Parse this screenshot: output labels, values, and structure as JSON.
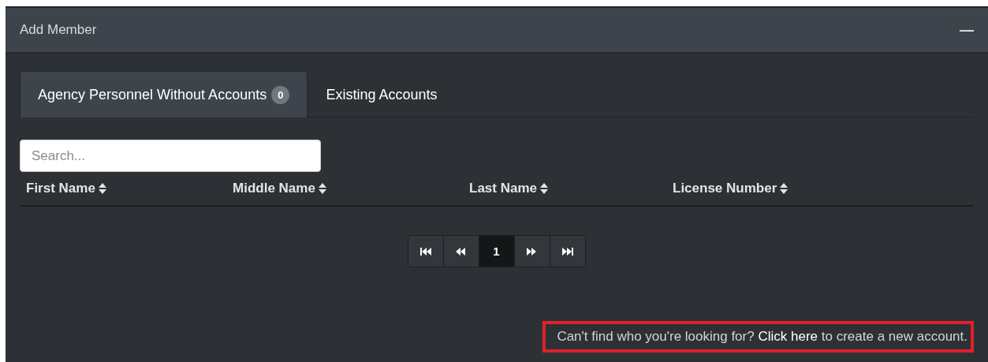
{
  "panel": {
    "title": "Add Member",
    "collapse_symbol": "—"
  },
  "tabs": [
    {
      "label": "Agency Personnel Without Accounts",
      "badge": "0",
      "selected": true
    },
    {
      "label": "Existing Accounts",
      "selected": false
    }
  ],
  "search": {
    "placeholder": "Search..."
  },
  "table": {
    "columns": [
      "First Name",
      "Middle Name",
      "Last Name",
      "License Number"
    ]
  },
  "pagination": [
    {
      "kind": "first"
    },
    {
      "kind": "prev"
    },
    {
      "kind": "page",
      "label": "1",
      "selected": true
    },
    {
      "kind": "next"
    },
    {
      "kind": "last"
    }
  ],
  "footer": {
    "before": "Can't find who you're looking for?",
    "link": "Click here",
    "after": "to create a new account.",
    "highlighted": true
  }
}
